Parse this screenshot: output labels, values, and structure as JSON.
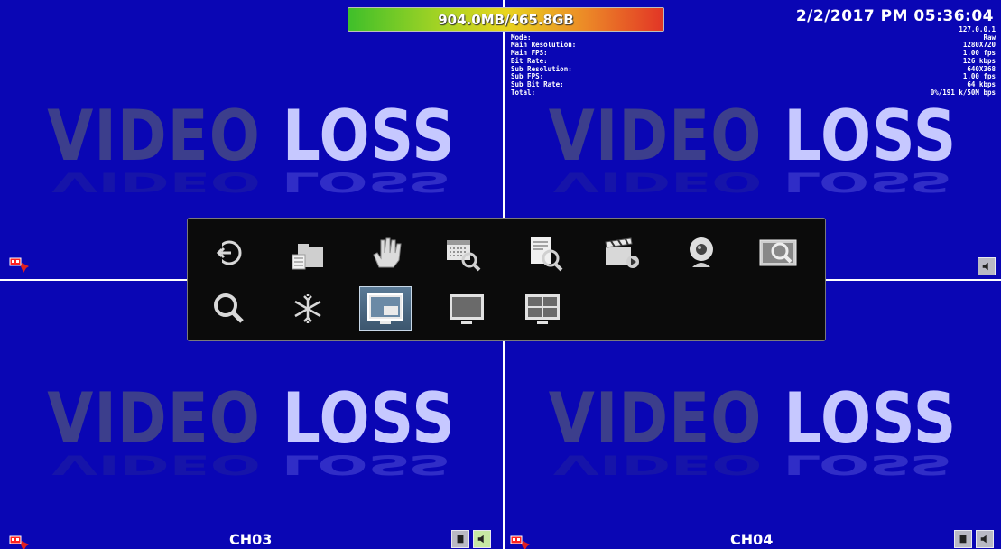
{
  "header": {
    "storage_text": "904.0MB/465.8GB",
    "datetime": "2/2/2017 PM 05:36:04"
  },
  "info_panel": {
    "ip": "127.0.0.1",
    "rows": [
      {
        "label": "Mode:",
        "value": "Raw"
      },
      {
        "label": "Main Resolution:",
        "value": "1280X720"
      },
      {
        "label": "Main FPS:",
        "value": "1.00 fps"
      },
      {
        "label": "Bit Rate:",
        "value": "126 kbps"
      },
      {
        "label": "Sub Resolution:",
        "value": "640X368"
      },
      {
        "label": "Sub FPS:",
        "value": "1.00 fps"
      },
      {
        "label": "Sub Bit Rate:",
        "value": "64 kbps"
      },
      {
        "label": "Total:",
        "value": "0%/191 k/50M bps"
      }
    ]
  },
  "channels": {
    "video_loss_word1": "VIDEO",
    "video_loss_word2": "LOSS",
    "ch3_label": "CH03",
    "ch4_label": "CH04"
  },
  "menu": {
    "row1": [
      "back-icon",
      "folder-icon",
      "hand-icon",
      "calendar-search-icon",
      "document-search-icon",
      "video-play-icon",
      "webcam-icon",
      "zoom-screen-icon"
    ],
    "row2": [
      "search-icon",
      "freeze-icon",
      "pip-layout-icon",
      "single-screen-icon",
      "quad-screen-icon"
    ],
    "selected": "pip-layout-icon"
  },
  "colors": {
    "channel_bg": "#0a06b4",
    "menu_bg": "#0b0b0b",
    "video_text_dark": "#3c3e8c",
    "video_text_light": "#c6c8ff"
  }
}
